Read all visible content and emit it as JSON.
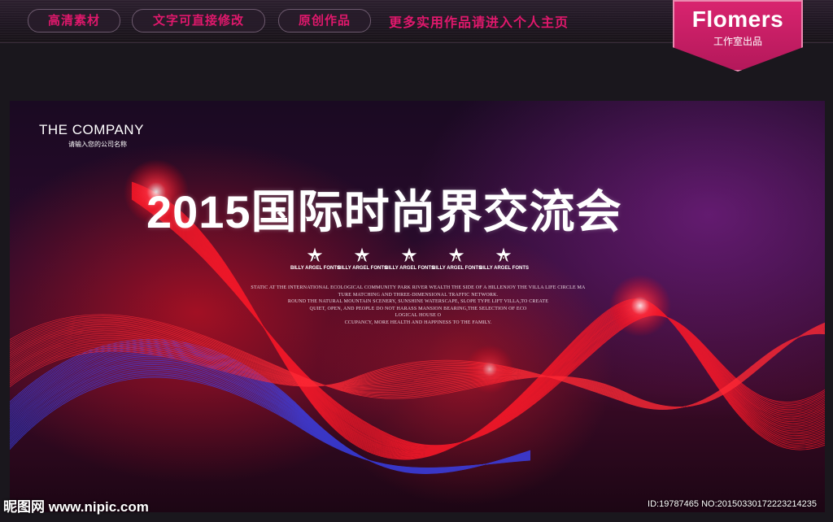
{
  "topbar": {
    "pills": [
      "高清素材",
      "文字可直接修改",
      "原创作品"
    ],
    "promo": "更多实用作品请进入个人主页",
    "brand_name": "Flomers",
    "brand_sub": "工作室出品"
  },
  "banner": {
    "company": "THE COMPANY",
    "company_sub": "请输入您的公司名称",
    "title": "2015国际时尚界交流会",
    "stars": [
      {
        "letter": "A",
        "label": "BILLY ARGEL FONTS"
      },
      {
        "letter": "A",
        "label": "BILLY ARGEL FONTS"
      },
      {
        "letter": "A",
        "label": "BILLY ARGEL FONTS"
      },
      {
        "letter": "A",
        "label": "BILLY ARGEL FONTS"
      },
      {
        "letter": "A",
        "label": "BILLY ARGEL FONTS"
      }
    ],
    "body_lines": [
      "STATIC AT THE INTERNATIONAL ECOLOGICAL COMMUNITY PARK RIVER WEALTH THE SIDE OF A HILLENJOY THE VILLA LIFE CIRCLE MA",
      "TURE MATCHING AND THREE-DIMENSIONAL TRAFFIC NETWORK.",
      "ROUND THE NATURAL MOUNTAIN SCENERY, SUNSHINE WATERSCAPE, SLOPE TYPE LIFT VILLA,TO CREATE",
      "QUIET, OPEN, AND PEOPLE DO NOT HARASS MANSION BEARING,THE SELECTION OF ECO",
      "LOGICAL HOUSE O",
      "CCUPANCY, MORE HEALTH AND HAPPINESS TO THE FAMILY."
    ]
  },
  "watermark": {
    "logo": "昵图网 www.nipic.com",
    "id_line": "ID:19787465 NO:20150330172223214235"
  },
  "colors": {
    "accent": "#e0186c",
    "brand_bg": "#c81e63",
    "wave_red": "#ff1a2a",
    "wave_blue": "#3a4cff"
  }
}
